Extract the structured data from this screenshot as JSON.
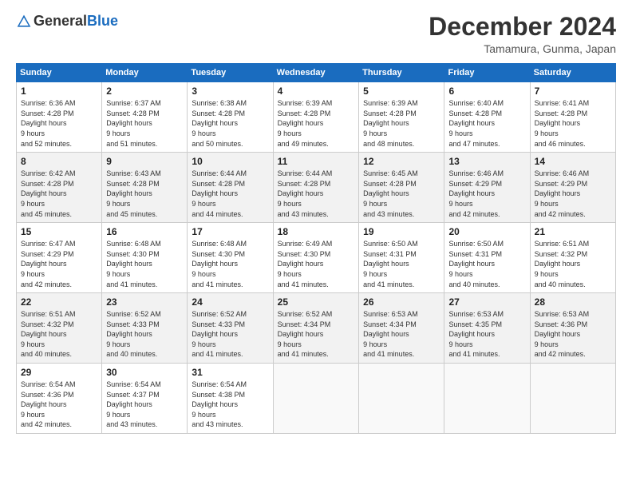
{
  "header": {
    "logo_general": "General",
    "logo_blue": "Blue",
    "month_title": "December 2024",
    "location": "Tamamura, Gunma, Japan"
  },
  "days_of_week": [
    "Sunday",
    "Monday",
    "Tuesday",
    "Wednesday",
    "Thursday",
    "Friday",
    "Saturday"
  ],
  "weeks": [
    [
      {
        "day": "1",
        "sunrise": "6:36 AM",
        "sunset": "4:28 PM",
        "daylight": "9 hours and 52 minutes."
      },
      {
        "day": "2",
        "sunrise": "6:37 AM",
        "sunset": "4:28 PM",
        "daylight": "9 hours and 51 minutes."
      },
      {
        "day": "3",
        "sunrise": "6:38 AM",
        "sunset": "4:28 PM",
        "daylight": "9 hours and 50 minutes."
      },
      {
        "day": "4",
        "sunrise": "6:39 AM",
        "sunset": "4:28 PM",
        "daylight": "9 hours and 49 minutes."
      },
      {
        "day": "5",
        "sunrise": "6:39 AM",
        "sunset": "4:28 PM",
        "daylight": "9 hours and 48 minutes."
      },
      {
        "day": "6",
        "sunrise": "6:40 AM",
        "sunset": "4:28 PM",
        "daylight": "9 hours and 47 minutes."
      },
      {
        "day": "7",
        "sunrise": "6:41 AM",
        "sunset": "4:28 PM",
        "daylight": "9 hours and 46 minutes."
      }
    ],
    [
      {
        "day": "8",
        "sunrise": "6:42 AM",
        "sunset": "4:28 PM",
        "daylight": "9 hours and 45 minutes."
      },
      {
        "day": "9",
        "sunrise": "6:43 AM",
        "sunset": "4:28 PM",
        "daylight": "9 hours and 45 minutes."
      },
      {
        "day": "10",
        "sunrise": "6:44 AM",
        "sunset": "4:28 PM",
        "daylight": "9 hours and 44 minutes."
      },
      {
        "day": "11",
        "sunrise": "6:44 AM",
        "sunset": "4:28 PM",
        "daylight": "9 hours and 43 minutes."
      },
      {
        "day": "12",
        "sunrise": "6:45 AM",
        "sunset": "4:28 PM",
        "daylight": "9 hours and 43 minutes."
      },
      {
        "day": "13",
        "sunrise": "6:46 AM",
        "sunset": "4:29 PM",
        "daylight": "9 hours and 42 minutes."
      },
      {
        "day": "14",
        "sunrise": "6:46 AM",
        "sunset": "4:29 PM",
        "daylight": "9 hours and 42 minutes."
      }
    ],
    [
      {
        "day": "15",
        "sunrise": "6:47 AM",
        "sunset": "4:29 PM",
        "daylight": "9 hours and 42 minutes."
      },
      {
        "day": "16",
        "sunrise": "6:48 AM",
        "sunset": "4:30 PM",
        "daylight": "9 hours and 41 minutes."
      },
      {
        "day": "17",
        "sunrise": "6:48 AM",
        "sunset": "4:30 PM",
        "daylight": "9 hours and 41 minutes."
      },
      {
        "day": "18",
        "sunrise": "6:49 AM",
        "sunset": "4:30 PM",
        "daylight": "9 hours and 41 minutes."
      },
      {
        "day": "19",
        "sunrise": "6:50 AM",
        "sunset": "4:31 PM",
        "daylight": "9 hours and 41 minutes."
      },
      {
        "day": "20",
        "sunrise": "6:50 AM",
        "sunset": "4:31 PM",
        "daylight": "9 hours and 40 minutes."
      },
      {
        "day": "21",
        "sunrise": "6:51 AM",
        "sunset": "4:32 PM",
        "daylight": "9 hours and 40 minutes."
      }
    ],
    [
      {
        "day": "22",
        "sunrise": "6:51 AM",
        "sunset": "4:32 PM",
        "daylight": "9 hours and 40 minutes."
      },
      {
        "day": "23",
        "sunrise": "6:52 AM",
        "sunset": "4:33 PM",
        "daylight": "9 hours and 40 minutes."
      },
      {
        "day": "24",
        "sunrise": "6:52 AM",
        "sunset": "4:33 PM",
        "daylight": "9 hours and 41 minutes."
      },
      {
        "day": "25",
        "sunrise": "6:52 AM",
        "sunset": "4:34 PM",
        "daylight": "9 hours and 41 minutes."
      },
      {
        "day": "26",
        "sunrise": "6:53 AM",
        "sunset": "4:34 PM",
        "daylight": "9 hours and 41 minutes."
      },
      {
        "day": "27",
        "sunrise": "6:53 AM",
        "sunset": "4:35 PM",
        "daylight": "9 hours and 41 minutes."
      },
      {
        "day": "28",
        "sunrise": "6:53 AM",
        "sunset": "4:36 PM",
        "daylight": "9 hours and 42 minutes."
      }
    ],
    [
      {
        "day": "29",
        "sunrise": "6:54 AM",
        "sunset": "4:36 PM",
        "daylight": "9 hours and 42 minutes."
      },
      {
        "day": "30",
        "sunrise": "6:54 AM",
        "sunset": "4:37 PM",
        "daylight": "9 hours and 43 minutes."
      },
      {
        "day": "31",
        "sunrise": "6:54 AM",
        "sunset": "4:38 PM",
        "daylight": "9 hours and 43 minutes."
      },
      null,
      null,
      null,
      null
    ]
  ]
}
